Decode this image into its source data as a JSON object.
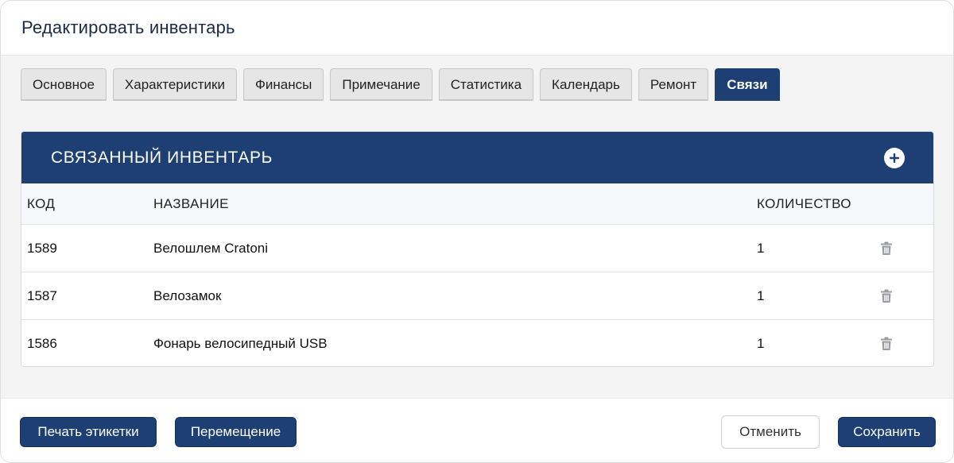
{
  "modal": {
    "title": "Редактировать инвентарь"
  },
  "tabs": [
    {
      "label": "Основное",
      "active": false
    },
    {
      "label": "Характеристики",
      "active": false
    },
    {
      "label": "Финансы",
      "active": false
    },
    {
      "label": "Примечание",
      "active": false
    },
    {
      "label": "Статистика",
      "active": false
    },
    {
      "label": "Календарь",
      "active": false
    },
    {
      "label": "Ремонт",
      "active": false
    },
    {
      "label": "Связи",
      "active": true
    }
  ],
  "panel": {
    "title": "СВЯЗАННЫЙ ИНВЕНТАРЬ",
    "add_icon": "plus-circle-icon"
  },
  "table": {
    "columns": {
      "code": "КОД",
      "name": "НАЗВАНИЕ",
      "quantity": "КОЛИЧЕСТВО"
    },
    "rows": [
      {
        "code": "1589",
        "name": "Велошлем Cratoni",
        "quantity": "1"
      },
      {
        "code": "1587",
        "name": "Велозамок",
        "quantity": "1"
      },
      {
        "code": "1586",
        "name": "Фонарь велосипедный USB",
        "quantity": "1"
      }
    ],
    "delete_icon": "trash-icon"
  },
  "footer": {
    "print_label": "Печать этикетки",
    "move_label": "Перемещение",
    "cancel_label": "Отменить",
    "save_label": "Сохранить"
  },
  "colors": {
    "primary": "#1e3f73",
    "tab_inactive": "#e6e6e7",
    "body_bg": "#f4f4f5",
    "icon_gray": "#9a9ca1"
  }
}
